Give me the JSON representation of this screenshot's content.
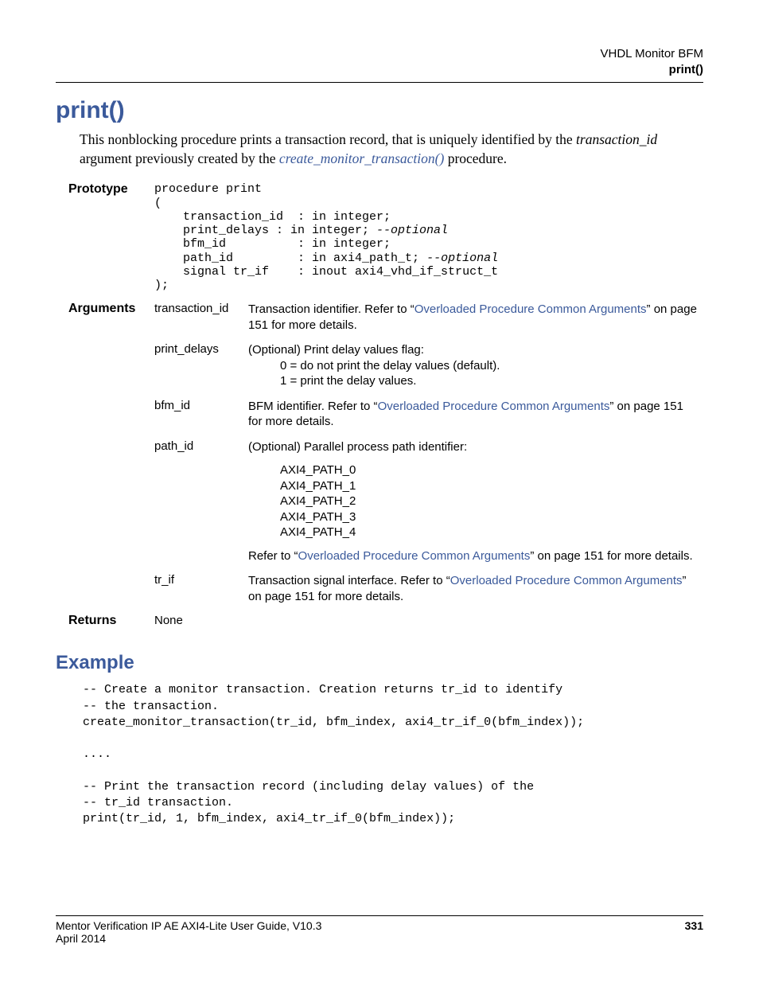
{
  "header": {
    "line1": "VHDL Monitor BFM",
    "line2": "print()"
  },
  "title": "print()",
  "intro": {
    "part1": "This nonblocking procedure prints a transaction record, that is uniquely identified by the ",
    "part2": "transaction_id",
    "part3": " argument previously created by the ",
    "link": "create_monitor_transaction()",
    "part4": " procedure."
  },
  "prototype": {
    "label": "Prototype",
    "code": "procedure print\n(\n    transaction_id  : in integer;\n    print_delays : in integer; --optional\n    bfm_id          : in integer;\n    path_id         : in axi4_path_t; --optional\n    signal tr_if    : inout axi4_vhd_if_struct_t\n);"
  },
  "arguments": {
    "label": "Arguments",
    "rows": [
      {
        "name": "transaction_id",
        "desc_pre": "Transaction identifier. Refer to “",
        "desc_link": "Overloaded Procedure Common Arguments",
        "desc_post": "” on page 151 for more details."
      },
      {
        "name": "print_delays",
        "desc_pre": "(Optional) Print delay values flag:",
        "opt0": "0 = do not print the delay values (default).",
        "opt1": "1 = print the delay values."
      },
      {
        "name": "bfm_id",
        "desc_pre": "BFM identifier. Refer to “",
        "desc_link": "Overloaded Procedure Common Arguments",
        "desc_post": "” on page 151 for more details."
      },
      {
        "name": "path_id",
        "desc_pre": "(Optional) Parallel process path identifier:",
        "p0": "AXI4_PATH_0",
        "p1": "AXI4_PATH_1",
        "p2": "AXI4_PATH_2",
        "p3": "AXI4_PATH_3",
        "p4": "AXI4_PATH_4",
        "refer_pre": "Refer to “",
        "refer_link": "Overloaded Procedure Common Arguments",
        "refer_post": "” on page 151 for more details."
      },
      {
        "name": "tr_if",
        "desc_pre": "Transaction signal interface. Refer to “",
        "desc_link": "Overloaded Procedure Common Arguments",
        "desc_post": "” on page 151 for more details."
      }
    ]
  },
  "returns": {
    "label": "Returns",
    "value": "None"
  },
  "example": {
    "label": "Example",
    "code": "-- Create a monitor transaction. Creation returns tr_id to identify\n-- the transaction.\ncreate_monitor_transaction(tr_id, bfm_index, axi4_tr_if_0(bfm_index));\n\n....\n\n-- Print the transaction record (including delay values) of the\n-- tr_id transaction.\nprint(tr_id, 1, bfm_index, axi4_tr_if_0(bfm_index));"
  },
  "footer": {
    "guide": "Mentor Verification IP AE AXI4-Lite User Guide, V10.3",
    "date": "April 2014",
    "page": "331"
  }
}
